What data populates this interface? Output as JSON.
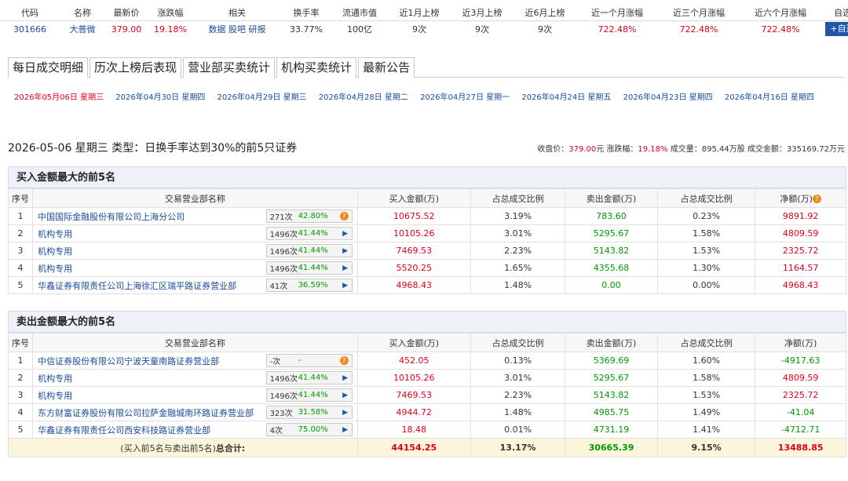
{
  "stock": {
    "headers": [
      "代码",
      "名称",
      "最新价",
      "涨跌幅",
      "相关",
      "换手率",
      "流通市值",
      "近1月上榜",
      "近3月上榜",
      "近6月上榜",
      "近一个月涨幅",
      "近三个月涨幅",
      "近六个月涨幅",
      "自选"
    ],
    "code": "301666",
    "name": "大普微",
    "price": "379.00",
    "change": "19.18%",
    "related": [
      "数据",
      "股吧",
      "研报"
    ],
    "turnover": "33.77%",
    "float_cap": "100亿",
    "m1": "9次",
    "m3": "9次",
    "m6": "9次",
    "rise1": "722.48%",
    "rise3": "722.48%",
    "rise6": "722.48%",
    "add_label": "+自选"
  },
  "tabs": [
    "每日成交明细",
    "历次上榜后表现",
    "营业部买卖统计",
    "机构买卖统计",
    "最新公告"
  ],
  "dates": [
    "2026年05月06日 星期三",
    "2026年04月30日 星期四",
    "2026年04月29日 星期三",
    "2026年04月28日 星期二",
    "2026年04月27日 星期一",
    "2026年04月24日 星期五",
    "2026年04月23日 星期四",
    "2026年04月16日 星期四"
  ],
  "title": "2026-05-06 星期三 类型：日换手率达到30%的前5只证券",
  "summary": {
    "close_label": "收盘价：",
    "close": "379.00",
    "close_unit": "元",
    "chg_label": "涨跌幅：",
    "chg": "19.18%",
    "vol_label": "成交量：",
    "vol": "895.44万股",
    "amt_label": "成交金额：",
    "amt": "335169.72万元"
  },
  "columns": [
    "序号",
    "交易营业部名称",
    "买入金额(万)",
    "占总成交比例",
    "卖出金额(万)",
    "占总成交比例",
    "净额(万)"
  ],
  "buy_section": {
    "title": "买入金额最大的前5名",
    "rows": [
      {
        "no": "1",
        "name": "中国国际金融股份有限公司上海分公司",
        "cnt": "271次",
        "pct": "42.80%",
        "icon": "dot",
        "buy": "10675.52",
        "buy_ratio": "3.19%",
        "sell": "783.60",
        "sell_ratio": "0.23%",
        "net": "9891.92",
        "net_color": "red"
      },
      {
        "no": "2",
        "name": "机构专用",
        "cnt": "1496次",
        "pct": "41.44%",
        "icon": "arrow",
        "buy": "10105.26",
        "buy_ratio": "3.01%",
        "sell": "5295.67",
        "sell_ratio": "1.58%",
        "net": "4809.59",
        "net_color": "red"
      },
      {
        "no": "3",
        "name": "机构专用",
        "cnt": "1496次",
        "pct": "41.44%",
        "icon": "arrow",
        "buy": "7469.53",
        "buy_ratio": "2.23%",
        "sell": "5143.82",
        "sell_ratio": "1.53%",
        "net": "2325.72",
        "net_color": "red"
      },
      {
        "no": "4",
        "name": "机构专用",
        "cnt": "1496次",
        "pct": "41.44%",
        "icon": "arrow",
        "buy": "5520.25",
        "buy_ratio": "1.65%",
        "sell": "4355.68",
        "sell_ratio": "1.30%",
        "net": "1164.57",
        "net_color": "red"
      },
      {
        "no": "5",
        "name": "华鑫证券有限责任公司上海徐汇区瑞平路证券营业部",
        "cnt": "41次",
        "pct": "36.59%",
        "icon": "arrow",
        "buy": "4968.43",
        "buy_ratio": "1.48%",
        "sell": "0.00",
        "sell_ratio": "0.00%",
        "net": "4968.43",
        "net_color": "red"
      }
    ]
  },
  "sell_section": {
    "title": "卖出金额最大的前5名",
    "rows": [
      {
        "no": "1",
        "name": "中信证券股份有限公司宁波天童南路证券营业部",
        "cnt": "-次",
        "pct": "-",
        "icon": "dot",
        "buy": "452.05",
        "buy_ratio": "0.13%",
        "sell": "5369.69",
        "sell_ratio": "1.60%",
        "net": "-4917.63",
        "net_color": "green"
      },
      {
        "no": "2",
        "name": "机构专用",
        "cnt": "1496次",
        "pct": "41.44%",
        "icon": "arrow",
        "buy": "10105.26",
        "buy_ratio": "3.01%",
        "sell": "5295.67",
        "sell_ratio": "1.58%",
        "net": "4809.59",
        "net_color": "red"
      },
      {
        "no": "3",
        "name": "机构专用",
        "cnt": "1496次",
        "pct": "41.44%",
        "icon": "arrow",
        "buy": "7469.53",
        "buy_ratio": "2.23%",
        "sell": "5143.82",
        "sell_ratio": "1.53%",
        "net": "2325.72",
        "net_color": "red"
      },
      {
        "no": "4",
        "name": "东方财富证券股份有限公司拉萨金融城南环路证券营业部",
        "cnt": "323次",
        "pct": "31.58%",
        "icon": "arrow",
        "buy": "4944.72",
        "buy_ratio": "1.48%",
        "sell": "4985.75",
        "sell_ratio": "1.49%",
        "net": "-41.04",
        "net_color": "green"
      },
      {
        "no": "5",
        "name": "华鑫证券有限责任公司西安科技路证券营业部",
        "cnt": "4次",
        "pct": "75.00%",
        "icon": "arrow",
        "buy": "18.48",
        "buy_ratio": "0.01%",
        "sell": "4731.19",
        "sell_ratio": "1.41%",
        "net": "-4712.71",
        "net_color": "green"
      }
    ],
    "total": {
      "label_prefix": "(买入前5名与卖出前5名)",
      "label_strong": "总合计:",
      "buy": "44154.25",
      "buy_ratio": "13.17%",
      "sell": "30665.39",
      "sell_ratio": "9.15%",
      "net": "13488.85"
    }
  },
  "colors": {
    "red": "#e0001b",
    "green": "#009900",
    "blue": "#1a4b9c",
    "accent": "#1f56a8"
  }
}
